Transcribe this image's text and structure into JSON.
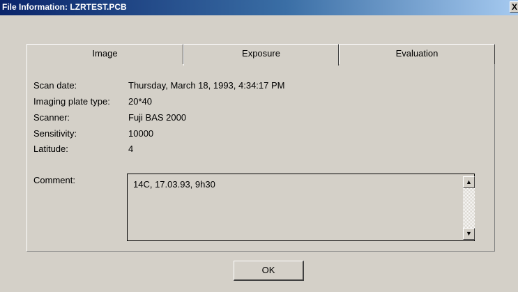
{
  "window": {
    "title": "File Information: LZRTEST.PCB",
    "close_glyph": "X"
  },
  "tabs": [
    {
      "label": "Image",
      "active": false
    },
    {
      "label": "Exposure",
      "active": true
    },
    {
      "label": "Evaluation",
      "active": false
    }
  ],
  "fields": [
    {
      "label": "Scan date:",
      "value": "Thursday, March 18, 1993, 4:34:17  PM"
    },
    {
      "label": "Imaging plate type:",
      "value": "20*40"
    },
    {
      "label": "Scanner:",
      "value": "Fuji BAS 2000"
    },
    {
      "label": "Sensitivity:",
      "value": "10000"
    },
    {
      "label": "Latitude:",
      "value": "4"
    }
  ],
  "comment": {
    "label": "Comment:",
    "value": "14C, 17.03.93, 9h30"
  },
  "scrollbar": {
    "up_glyph": "▲",
    "down_glyph": "▼"
  },
  "ok_button": {
    "label": "OK"
  }
}
